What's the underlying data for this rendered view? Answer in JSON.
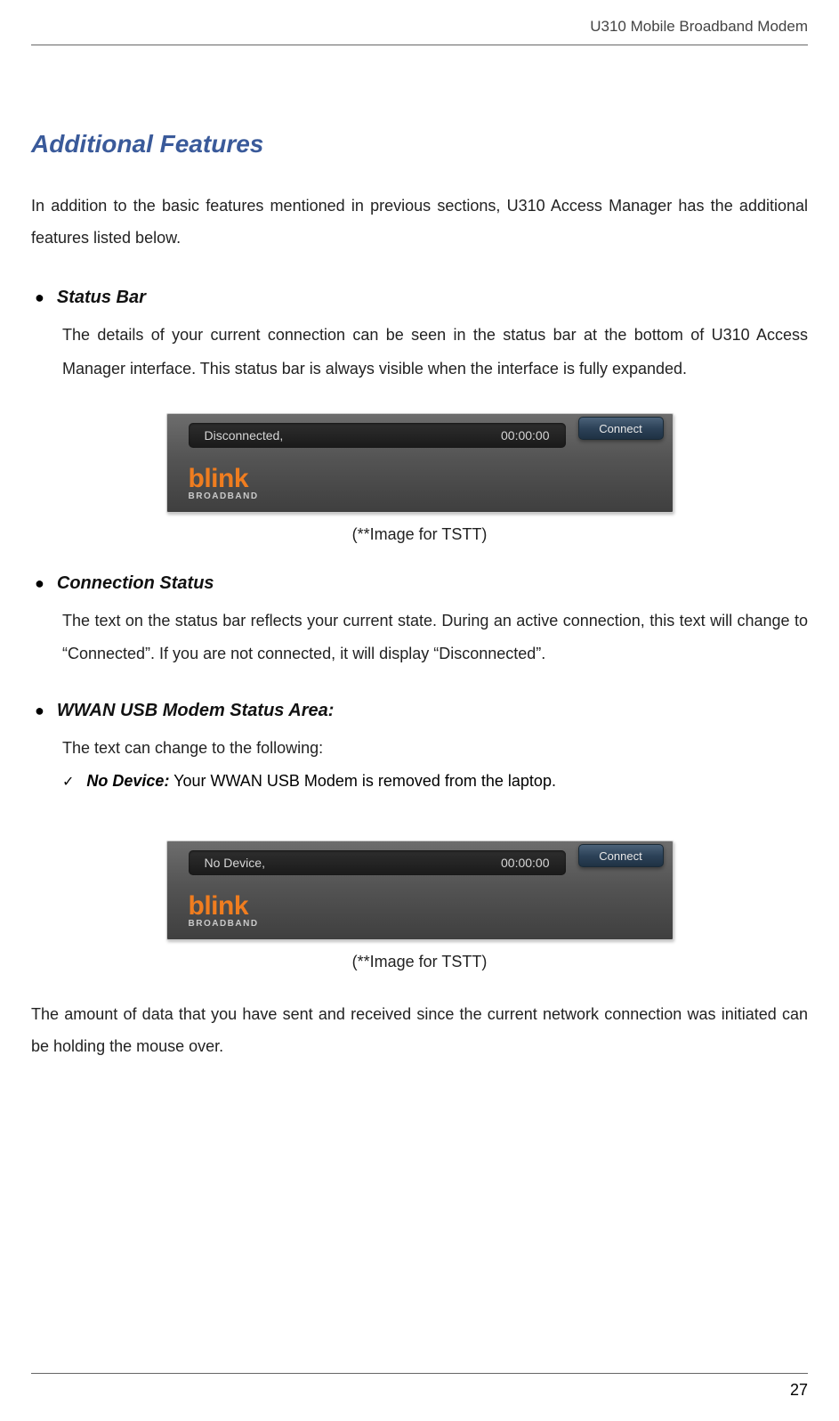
{
  "header": {
    "title": "U310 Mobile Broadband Modem"
  },
  "section": {
    "title": "Additional Features"
  },
  "intro": "In addition to the basic features mentioned in previous sections, U310 Access Manager has the additional features listed below.",
  "bullets": {
    "statusBar": {
      "title": "Status Bar",
      "body": "The details of your current connection can be seen in the status bar at the bottom of U310 Access Manager interface. This status bar is always visible when the interface is fully expanded."
    },
    "connectionStatus": {
      "title": "Connection Status",
      "body": "The text on the status bar reflects your current state. During an active connection, this text will change to “Connected”.  If you are not connected, it will display “Disconnected”."
    },
    "wwan": {
      "title": "WWAN USB Modem Status Area:",
      "body": "The text can change to the following:",
      "sub": {
        "label": "No Device:",
        "text": " Your WWAN USB Modem is removed from the laptop."
      }
    }
  },
  "figure1": {
    "status": "Disconnected,",
    "time": "00:00:00",
    "brand": "blink",
    "brandSub": "BROADBAND",
    "button": "Connect",
    "caption": "(**Image for TSTT)"
  },
  "figure2": {
    "status": "No Device,",
    "time": "00:00:00",
    "brand": "blink",
    "brandSub": "BROADBAND",
    "button": "Connect",
    "caption": "(**Image for TSTT)"
  },
  "closing": "The amount of data that you have sent and received since the current network connection was initiated can be holding the mouse over.",
  "footer": {
    "pageNumber": "27"
  }
}
